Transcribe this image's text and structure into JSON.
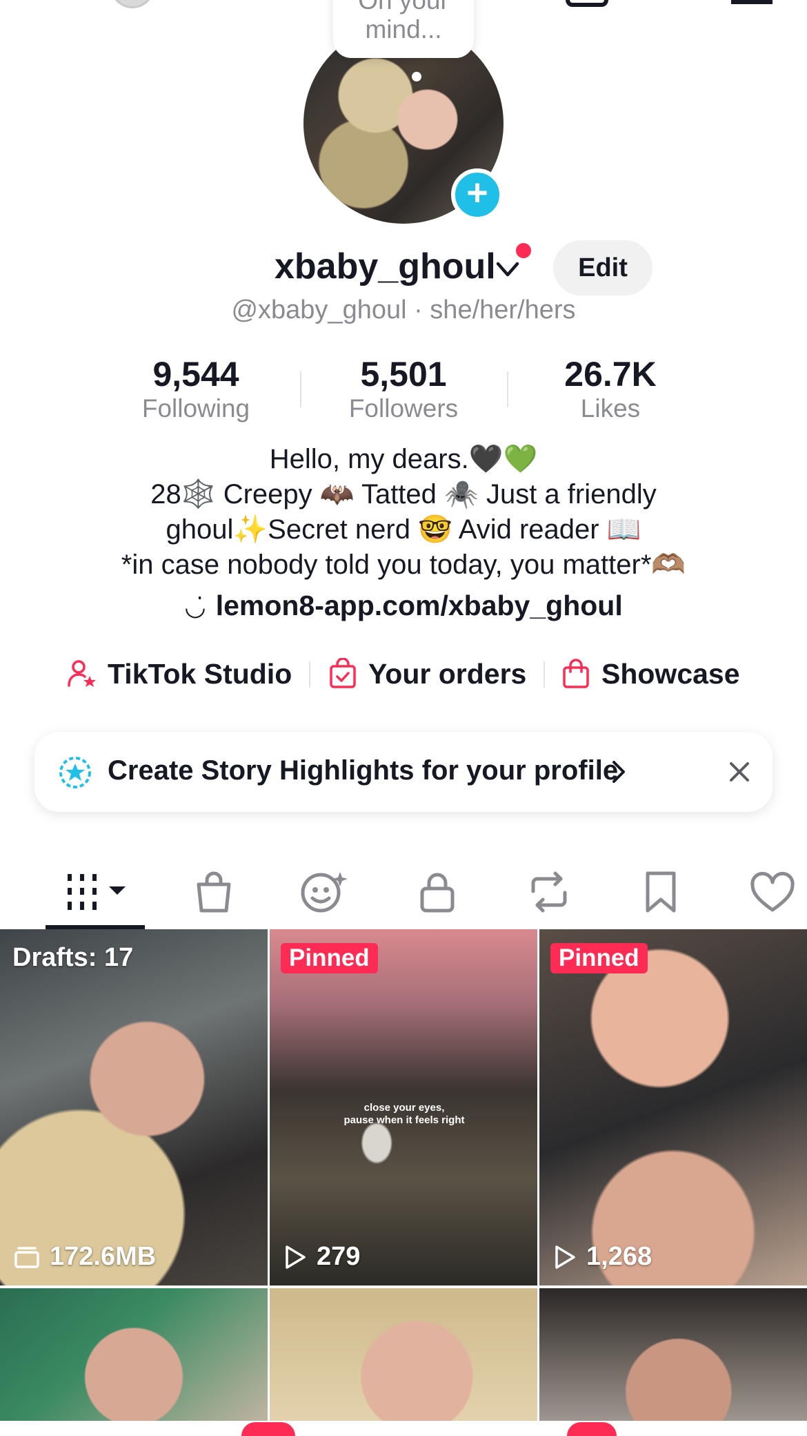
{
  "note": {
    "text": "On your\nmind..."
  },
  "profile": {
    "username": "xbaby_ghoul",
    "handle": "@xbaby_ghoul · she/her/hers",
    "edit_label": "Edit"
  },
  "stats": [
    {
      "value": "9,544",
      "label": "Following"
    },
    {
      "value": "5,501",
      "label": "Followers"
    },
    {
      "value": "26.7K",
      "label": "Likes"
    }
  ],
  "bio": {
    "line1": "Hello, my dears.🖤💚",
    "line2": "28🕸️ Creepy 🦇 Tatted 🕷️ Just a friendly",
    "line3": "ghoul✨Secret nerd 🤓 Avid reader 📖",
    "line4": "*in case nobody told you today, you matter*🫶🏽",
    "link": "lemon8-app.com/xbaby_ghoul"
  },
  "quick_links": [
    {
      "label": "TikTok Studio"
    },
    {
      "label": "Your orders"
    },
    {
      "label": "Showcase"
    }
  ],
  "banner": {
    "text": "Create Story Highlights for your profile"
  },
  "tabs": [
    "videos-tab",
    "shop-tab",
    "ai-self-tab",
    "private-tab",
    "reposts-tab",
    "favorites-tab",
    "liked-tab"
  ],
  "grid": {
    "drafts": "Drafts: 17",
    "drafts_size": "172.6MB",
    "pinned_label": "Pinned",
    "video2_caption": "close your eyes,\npause when it feels right",
    "video2_views": "279",
    "video3_views": "1,268"
  },
  "colors": {
    "accent": "#fe2c55",
    "blue": "#20bfe8",
    "text": "#161823",
    "muted": "#8a8b91"
  }
}
